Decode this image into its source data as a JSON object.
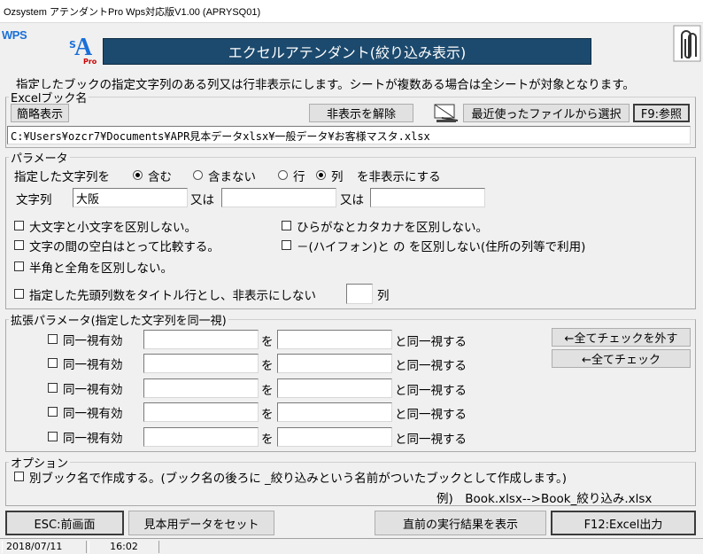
{
  "window": {
    "title": "Ozsystem アテンダントPro Wps対応版V1.00 (APRYSQ01)"
  },
  "header": {
    "wps_label": "WPS",
    "logo_small": "S",
    "logo_big": "A",
    "logo_sub": "Pro",
    "banner": "エクセルアテンダント(絞り込み表示)"
  },
  "description": "指定したブックの指定文字列のある列又は行非表示にします。シートが複数ある場合は全シートが対象となります。",
  "book": {
    "legend": "Excelブック名",
    "simple_view": "簡略表示",
    "unhide": "非表示を解除",
    "recent": "最近使ったファイルから選択",
    "browse": "F9:参照",
    "path": "C:¥Users¥ozcr7¥Documents¥APR見本データxlsx¥一般データ¥お客様マスタ.xlsx"
  },
  "params": {
    "legend": "パラメータ",
    "mode_prefix": "指定した文字列を",
    "opt_include": "含む",
    "opt_exclude": "含まない",
    "opt_row": "行",
    "opt_col": "列",
    "mode_suffix": "を非表示にする",
    "string_label": "文字列",
    "or1": "又は",
    "or2": "又は",
    "string1": "大阪",
    "string2": "",
    "string3": "",
    "case": "大文字と小文字を区別しない。",
    "hira": "ひらがなとカタカナを区別しない。",
    "space": "文字の間の空白はとって比較する。",
    "hyphen": "－(ハイフォン)と の を区別しない(住所の列等で利用)",
    "width": "半角と全角を区別しない。",
    "title_rows": "指定した先頭列数をタイトル行とし、非表示にしない",
    "title_rows_value": "",
    "title_rows_unit": "列"
  },
  "ext": {
    "legend": "拡張パラメータ(指定した文字列を同一視)",
    "uncheck_all": "←全てチェックを外す",
    "check_all": "←全てチェック",
    "rows": [
      {
        "label": "同一視有効",
        "wo": "を",
        "suffix": "と同一視する",
        "a": "",
        "b": ""
      },
      {
        "label": "同一視有効",
        "wo": "を",
        "suffix": "と同一視する",
        "a": "",
        "b": ""
      },
      {
        "label": "同一視有効",
        "wo": "を",
        "suffix": "と同一視する",
        "a": "",
        "b": ""
      },
      {
        "label": "同一視有効",
        "wo": "を",
        "suffix": "と同一視する",
        "a": "",
        "b": ""
      },
      {
        "label": "同一視有効",
        "wo": "を",
        "suffix": "と同一視する",
        "a": "",
        "b": ""
      }
    ]
  },
  "options": {
    "legend": "オプション",
    "separate": "別ブック名で作成する。(ブック名の後ろに _絞り込みという名前がついたブックとして作成します。)",
    "example": "例)　Book.xlsx-->Book_絞り込み.xlsx"
  },
  "footer": {
    "esc": "ESC:前画面",
    "sample": "見本用データをセット",
    "last_result": "直前の実行結果を表示",
    "excel_out": "F12:Excel出力"
  },
  "status": {
    "date": "2018/07/11",
    "time": "16:02"
  }
}
